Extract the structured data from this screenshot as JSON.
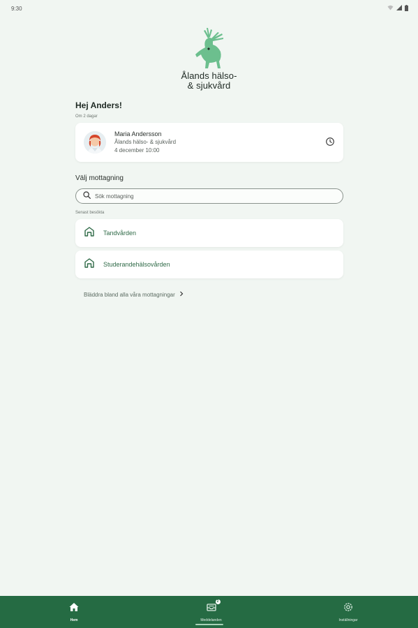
{
  "status_bar": {
    "time": "9:30"
  },
  "logo": {
    "line1": "Ålands hälso-",
    "line2": "& sjukvård"
  },
  "greeting": "Hej Anders!",
  "appointment": {
    "relative_time": "Om 2 dagar",
    "name": "Maria Andersson",
    "organization": "Ålands hälso- & sjukvård",
    "datetime": "4 december 10:00",
    "icon": "clock-icon"
  },
  "clinic_section": {
    "title": "Välj mottagning",
    "search_placeholder": "Sök mottagning",
    "recent_label": "Senast besökta",
    "items": [
      {
        "label": "Tandvården",
        "icon": "home-icon"
      },
      {
        "label": "Studerandehälsovården",
        "icon": "home-icon"
      }
    ],
    "browse_label": "Bläddra bland alla våra mottagningar"
  },
  "bottom_nav": {
    "items": [
      {
        "label": "Hem",
        "icon": "home-icon",
        "active": true
      },
      {
        "label": "Meddelanden",
        "icon": "inbox-icon",
        "badge": "2",
        "active": false
      },
      {
        "label": "Inställningar",
        "icon": "gear-icon",
        "active": false
      }
    ]
  },
  "colors": {
    "brand": "#256b43",
    "background": "#f1f6f2",
    "logo_green": "#6cbf8e"
  }
}
